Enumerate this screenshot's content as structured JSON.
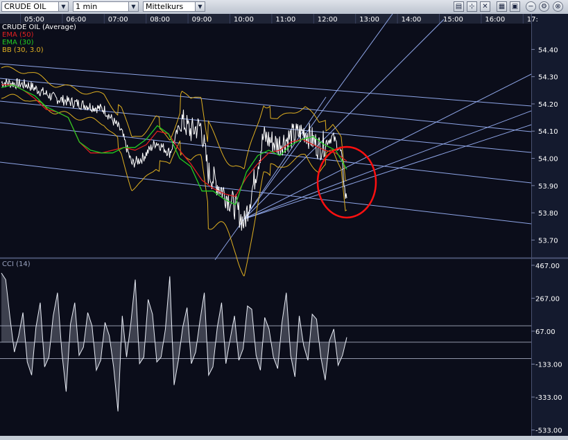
{
  "toolbar": {
    "instrument": "CRUDE OIL",
    "interval": "1 min",
    "price_type": "Mittelkurs",
    "buttons": [
      "chart-grid-icon",
      "crosshair-icon",
      "delete-icon",
      "layout-icon",
      "settings-icon",
      "zoom-out-icon",
      "close-icon"
    ]
  },
  "colors": {
    "background": "#0b0d1a",
    "grid": "#283049",
    "price": "#ffffff",
    "ema50": "#e02020",
    "ema30": "#22cc22",
    "bb": "#e0b020",
    "trend": "#8fa6e8",
    "circle": "#ff1010",
    "axis_text": "#ffffff"
  },
  "chart_data": [
    {
      "type": "line",
      "title": "CRUDE OIL (Average)",
      "x_ticks": [
        "05:00",
        "06:00",
        "07:00",
        "08:00",
        "09:00",
        "10:00",
        "11:00",
        "12:00",
        "13:00",
        "14:00",
        "15:00",
        "16:00",
        "17:"
      ],
      "y_ticks": [
        "54.40",
        "54.30",
        "54.20",
        "54.10",
        "54.00",
        "53.90",
        "53.80",
        "53.70"
      ],
      "ylim": [
        53.64,
        54.49
      ],
      "series": [
        {
          "name": "EMA (50)",
          "color": "#e02020",
          "values": [
            54.27,
            54.27,
            54.25,
            54.22,
            54.18,
            54.17,
            54.15,
            54.06,
            54.02,
            54.02,
            54.03,
            54.04,
            54.03,
            54.05,
            54.1,
            54.09,
            54.03,
            53.98,
            53.92,
            53.89,
            53.87,
            53.86,
            53.93,
            53.98,
            54.02,
            54.03,
            54.06,
            54.07,
            54.05,
            54.03,
            54.02,
            53.99
          ]
        },
        {
          "name": "EMA (30)",
          "color": "#22cc22",
          "values": [
            54.26,
            54.27,
            54.25,
            54.23,
            54.19,
            54.17,
            54.15,
            54.06,
            54.03,
            54.02,
            54.02,
            54.04,
            54.04,
            54.07,
            54.12,
            54.09,
            54.0,
            53.97,
            53.88,
            53.88,
            53.85,
            53.83,
            53.95,
            54.01,
            54.03,
            54.01,
            54.05,
            54.07,
            54.08,
            54.05,
            54.03,
            53.96
          ]
        },
        {
          "name": "BB (30, 3.0)",
          "color": "#e0b020",
          "values": []
        }
      ],
      "annotations": [
        "red circle around final drop near 12:30"
      ]
    },
    {
      "type": "line",
      "title": "CCI (14)",
      "y_ticks": [
        "467.00",
        "267.00",
        "67.00",
        "-133.00",
        "-333.00",
        "-533.00"
      ],
      "ylim": [
        -560,
        500
      ],
      "series": [
        {
          "name": "CCI",
          "color": "#ffffff",
          "values": [
            420,
            380,
            150,
            -60,
            40,
            180,
            -120,
            -200,
            90,
            240,
            -150,
            -90,
            160,
            300,
            -60,
            -300,
            110,
            240,
            -80,
            -30,
            180,
            100,
            -170,
            -110,
            120,
            40,
            -150,
            -420,
            160,
            -90,
            120,
            380,
            -130,
            -90,
            260,
            170,
            -120,
            -90,
            80,
            400,
            -260,
            -110,
            90,
            210,
            -130,
            -60,
            130,
            300,
            -200,
            -150,
            90,
            240,
            -130,
            20,
            160,
            -110,
            -40,
            220,
            200,
            -80,
            -170,
            150,
            80,
            -90,
            -160,
            120,
            300,
            -80,
            -210,
            160,
            -20,
            -110,
            170,
            140,
            -90,
            -230,
            10,
            80,
            -140,
            -80,
            30
          ]
        }
      ],
      "reference_lines": [
        100,
        0,
        -100
      ]
    }
  ]
}
